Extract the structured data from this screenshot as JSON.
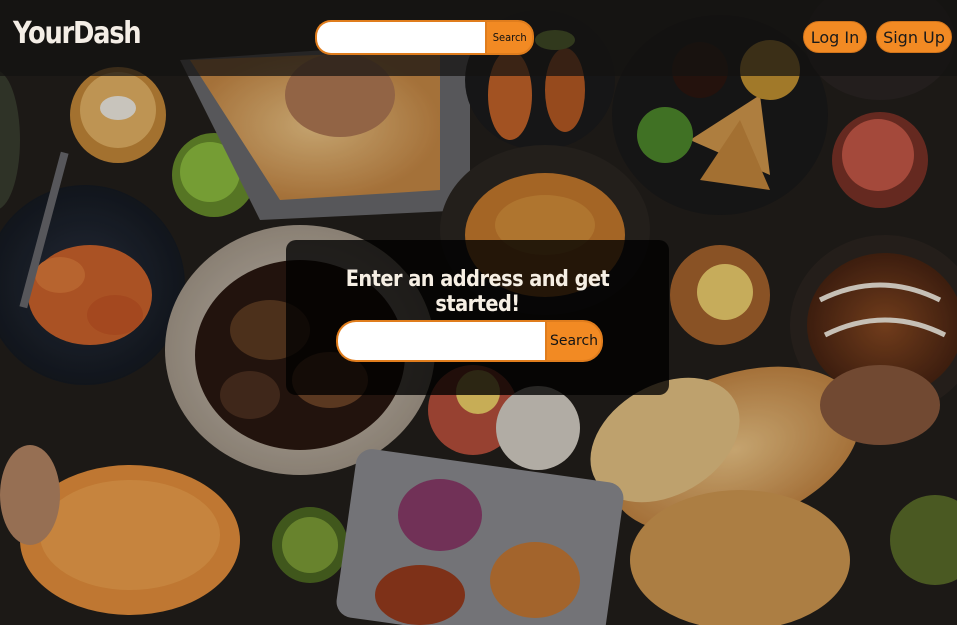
{
  "header": {
    "logo": "YourDash",
    "search": {
      "value": "",
      "placeholder": "",
      "button_label": "Search"
    },
    "login_label": "Log In",
    "signup_label": "Sign Up"
  },
  "hero": {
    "title": "Enter an address and get started!",
    "search": {
      "value": "",
      "placeholder": "",
      "button_label": "Search"
    }
  },
  "colors": {
    "accent": "#f28a23",
    "accent_border": "#e07d1d",
    "header_bg": "#141210",
    "card_bg": "#000000",
    "logo_text": "#f4eee6"
  }
}
